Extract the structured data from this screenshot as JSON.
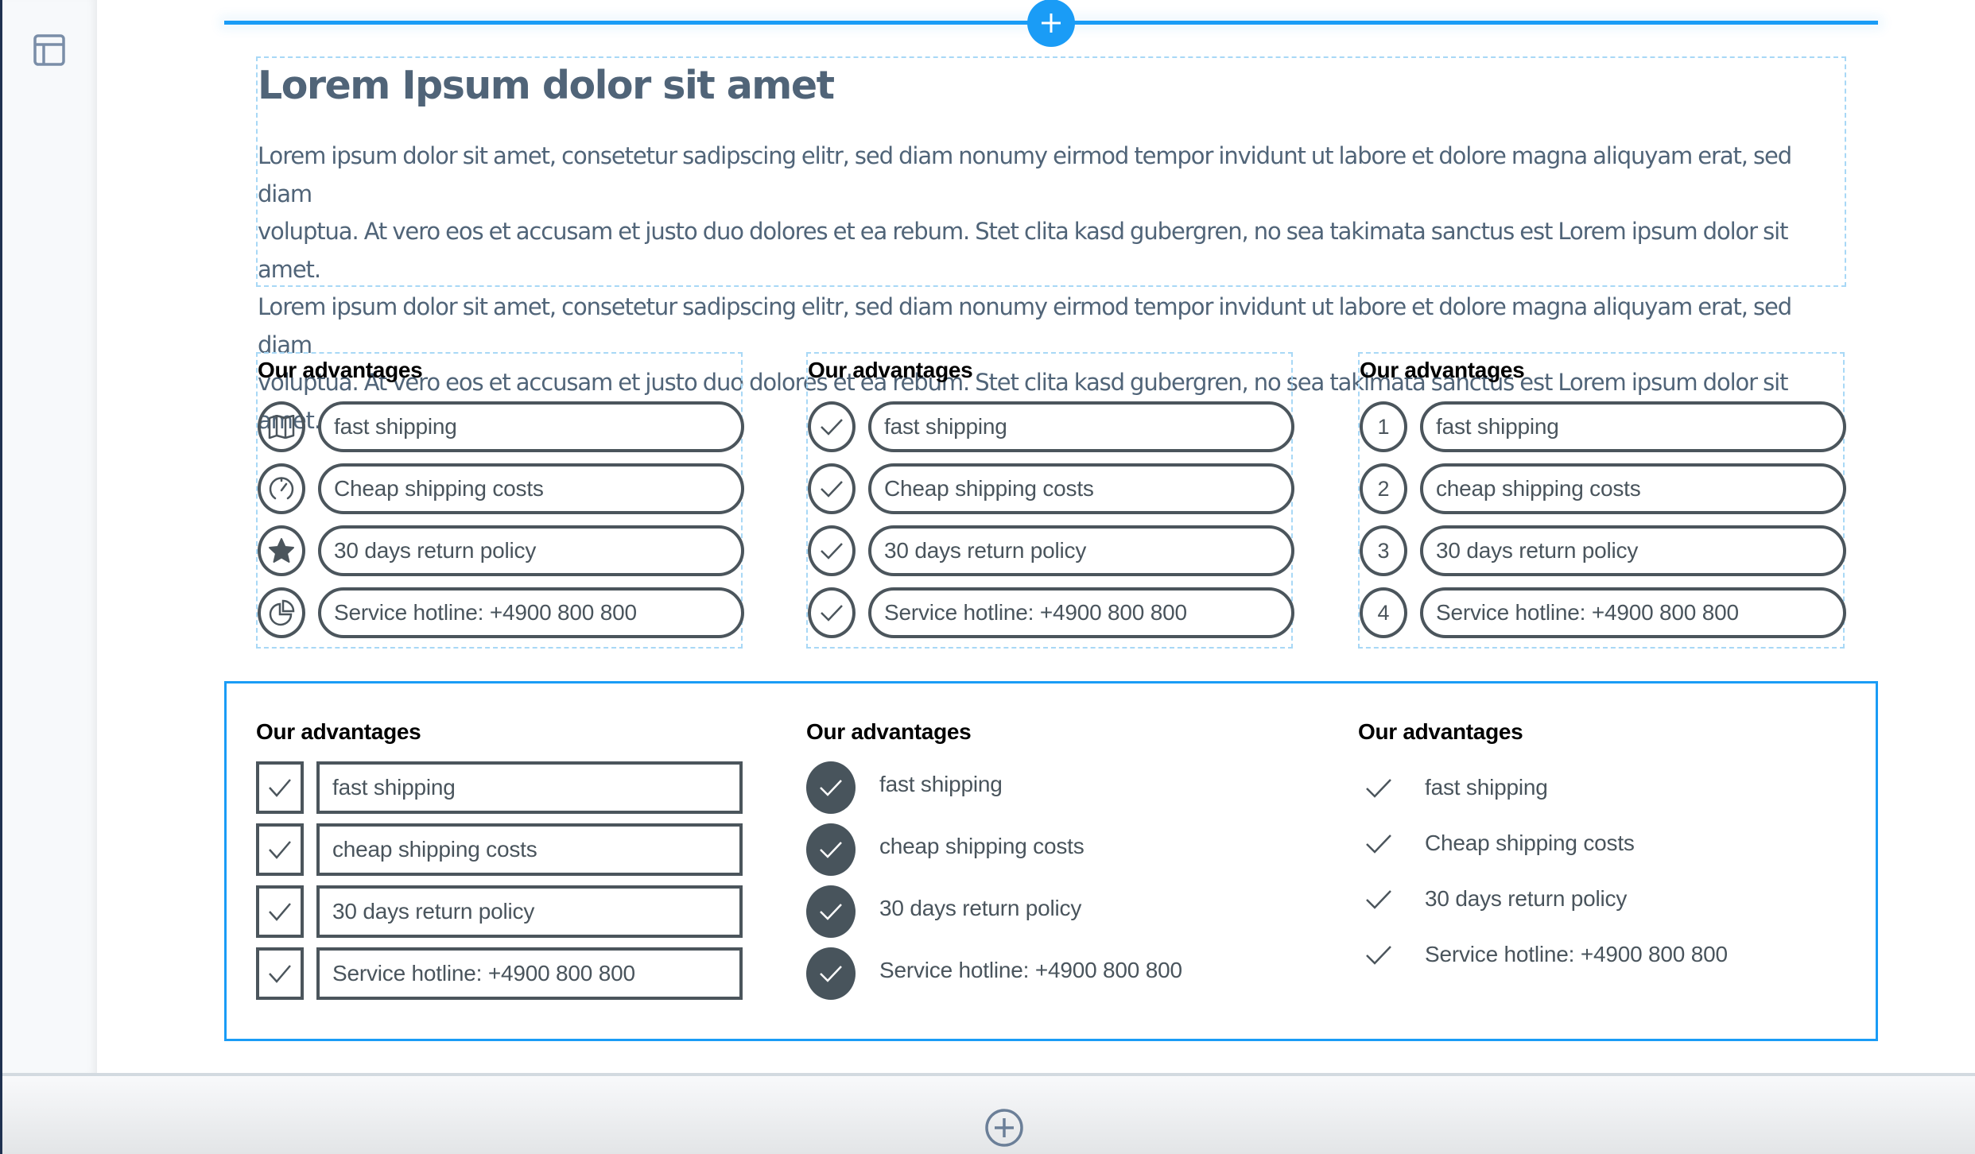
{
  "sidebar": {
    "icons": [
      {
        "name": "layout-icon"
      }
    ]
  },
  "insert_bar": {
    "icon": "plus-icon",
    "accent_color": "#1a9cf6"
  },
  "text_block": {
    "heading": "Lorem Ipsum dolor sit amet",
    "lines": [
      "Lorem ipsum dolor sit amet, consetetur sadipscing elitr, sed diam nonumy eirmod tempor invidunt ut labore et dolore magna aliquyam erat, sed diam",
      "voluptua. At vero eos et accusam et justo duo dolores et ea rebum. Stet clita kasd gubergren, no sea takimata sanctus est Lorem ipsum dolor sit amet.",
      "Lorem ipsum dolor sit amet, consetetur sadipscing elitr, sed diam nonumy eirmod tempor invidunt ut labore et dolore magna aliquyam erat, sed diam",
      "voluptua. At vero eos et accusam et justo duo dolores et ea rebum. Stet clita kasd gubergren, no sea takimata sanctus est Lorem ipsum dolor sit amet."
    ]
  },
  "advantage_blocks": [
    {
      "title": "Our advantages",
      "style": "icon-circles-pills",
      "items": [
        {
          "icon": "map-icon",
          "label": "fast shipping"
        },
        {
          "icon": "speedometer-icon",
          "label": "Cheap shipping costs"
        },
        {
          "icon": "star-icon",
          "label": "30 days return policy"
        },
        {
          "icon": "pie-chart-icon",
          "label": "Service hotline: +4900 800 800"
        }
      ]
    },
    {
      "title": "Our advantages",
      "style": "check-circles-pills",
      "items": [
        {
          "icon": "check-icon",
          "label": "fast shipping"
        },
        {
          "icon": "check-icon",
          "label": "Cheap shipping costs"
        },
        {
          "icon": "check-icon",
          "label": "30 days return policy"
        },
        {
          "icon": "check-icon",
          "label": "Service hotline: +4900 800 800"
        }
      ]
    },
    {
      "title": "Our advantages",
      "style": "numbered-circles-pills",
      "items": [
        {
          "number": "1",
          "label": "fast shipping"
        },
        {
          "number": "2",
          "label": "cheap shipping costs"
        },
        {
          "number": "3",
          "label": "30 days return policy"
        },
        {
          "number": "4",
          "label": "Service hotline: +4900 800 800"
        }
      ]
    },
    {
      "title": "Our advantages",
      "style": "checkbox-boxes",
      "items": [
        {
          "icon": "check-icon",
          "label": "fast shipping"
        },
        {
          "icon": "check-icon",
          "label": "cheap shipping costs"
        },
        {
          "icon": "check-icon",
          "label": "30 days return policy"
        },
        {
          "icon": "check-icon",
          "label": "Service hotline: +4900 800 800"
        }
      ]
    },
    {
      "title": "Our advantages",
      "style": "filled-check-circles",
      "items": [
        {
          "icon": "check-circle-filled-icon",
          "label": "fast shipping"
        },
        {
          "icon": "check-circle-filled-icon",
          "label": "cheap shipping costs"
        },
        {
          "icon": "check-circle-filled-icon",
          "label": "30 days return policy"
        },
        {
          "icon": "check-circle-filled-icon",
          "label": "Service hotline: +4900 800 800"
        }
      ]
    },
    {
      "title": "Our advantages",
      "style": "plain-checks",
      "items": [
        {
          "icon": "check-icon",
          "label": "fast shipping"
        },
        {
          "icon": "check-icon",
          "label": "Cheap shipping costs"
        },
        {
          "icon": "check-icon",
          "label": "30 days return policy"
        },
        {
          "icon": "check-icon",
          "label": "Service hotline: +4900 800 800"
        }
      ]
    }
  ],
  "bottom_bar": {
    "add_icon": "plus-circle-icon"
  },
  "colors": {
    "accent": "#1a9cf6",
    "dashed_outline": "#a8d8f6",
    "item_stroke": "#4b555c",
    "heading_text": "#506478"
  }
}
